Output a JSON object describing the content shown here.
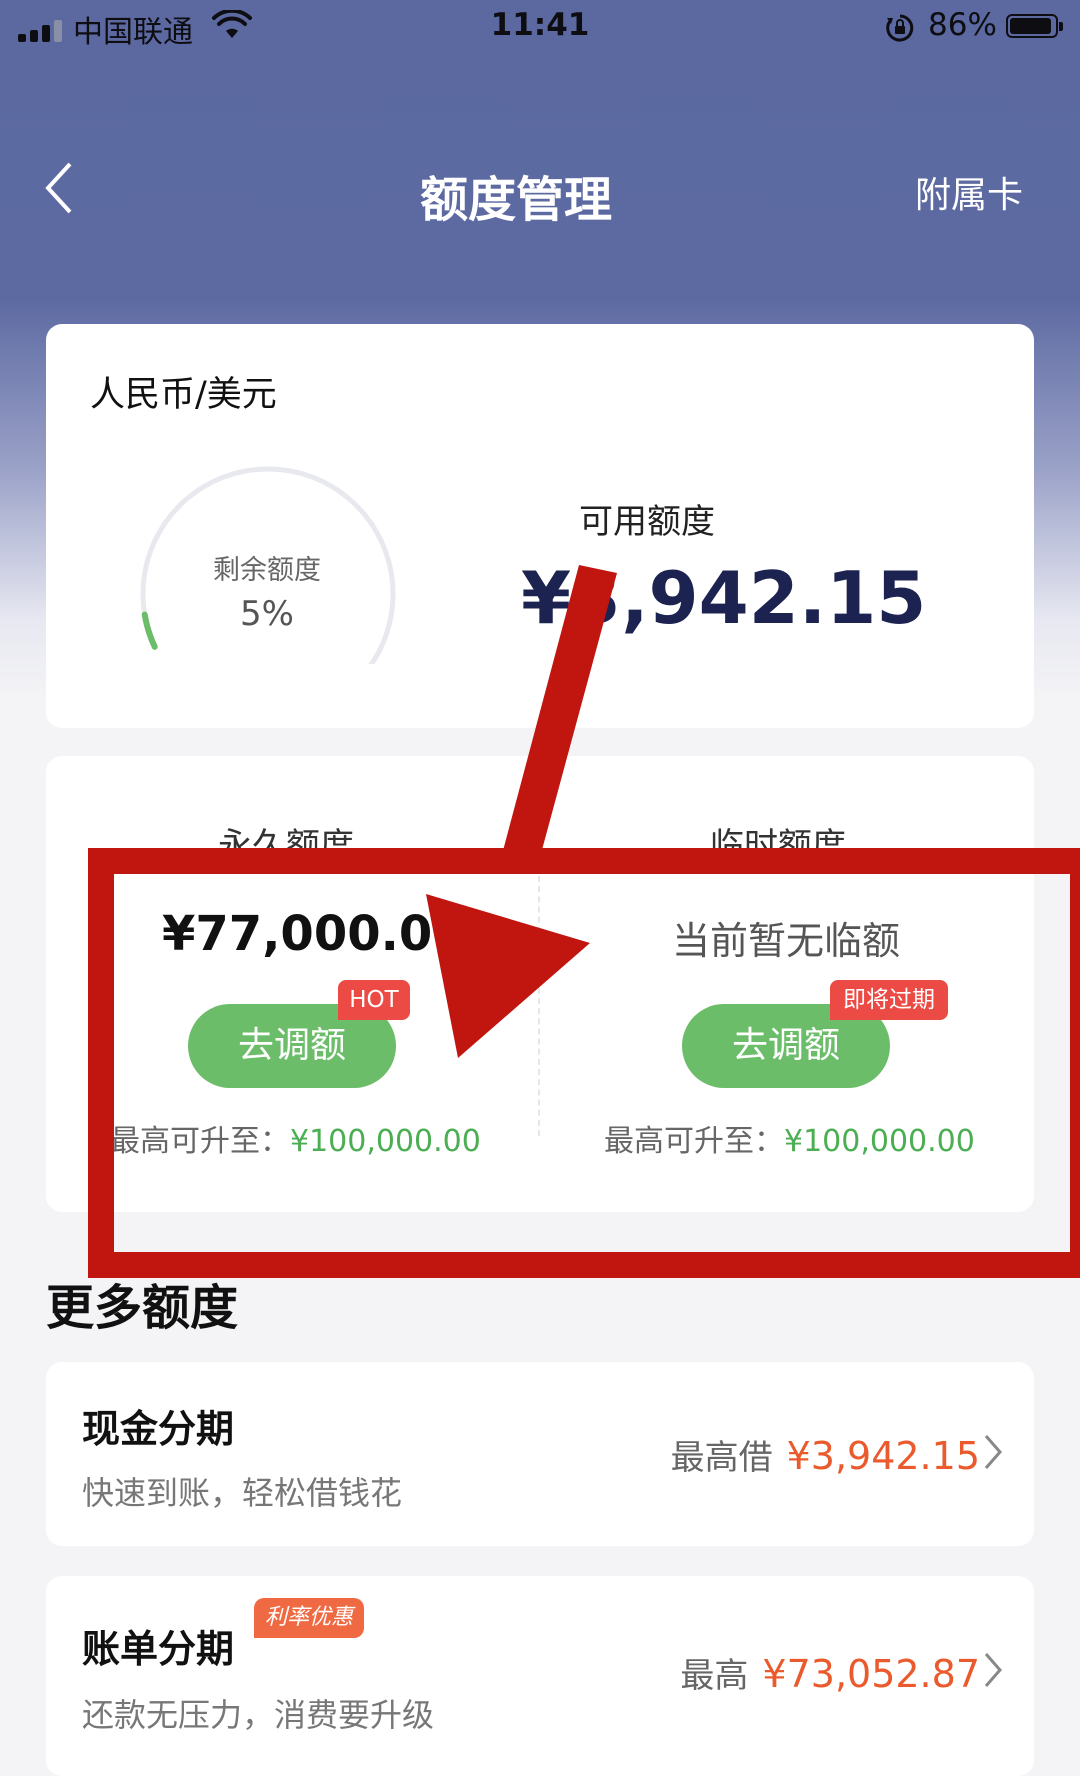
{
  "status_bar": {
    "carrier": "中国联通",
    "time": "11:41",
    "battery": "86%"
  },
  "nav": {
    "title": "额度管理",
    "right": "附属卡"
  },
  "summary": {
    "currency": "人民币/美元",
    "gauge_label": "剩余额度",
    "gauge_value": "5%",
    "gauge_fraction": 0.05,
    "available_label": "可用额度",
    "available_value": "¥3,942.15"
  },
  "limits": {
    "fixed": {
      "label": "永久额度",
      "amount": "¥77,000.00",
      "badge": "HOT",
      "button": "去调额",
      "max_label": "最高可升至：",
      "max_value": "¥100,000.00"
    },
    "temp": {
      "label": "临时额度",
      "amount": "当前暂无临额",
      "badge": "即将过期",
      "button": "去调额",
      "max_label": "最高可升至：",
      "max_value": "¥100,000.00"
    }
  },
  "more": {
    "title": "更多额度",
    "items": [
      {
        "title": "现金分期",
        "subtitle": "快速到账，轻松借钱花",
        "right_label": "最高借",
        "right_value": "¥3,942.15"
      },
      {
        "title": "账单分期",
        "badge": "利率优惠",
        "subtitle": "还款无压力，消费要升级",
        "right_label": "最高",
        "right_value": "¥73,052.87"
      }
    ]
  },
  "colors": {
    "header": "#5d6aa2",
    "green": "#6cbd6a",
    "orange": "#ea5a2c",
    "annotation_red": "#c0160f"
  }
}
